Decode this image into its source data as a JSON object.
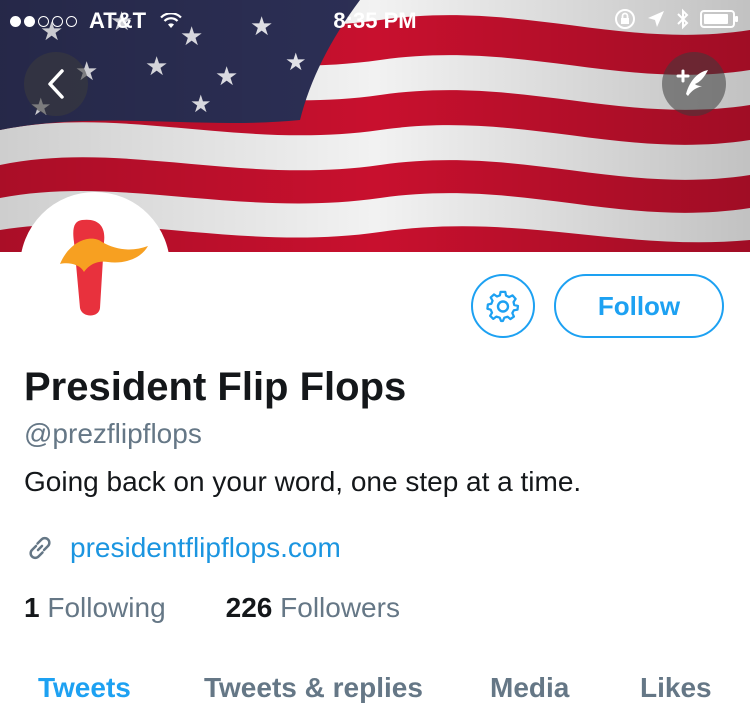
{
  "status_bar": {
    "carrier": "AT&T",
    "time": "8:35 PM",
    "signal_filled": 2,
    "signal_total": 5
  },
  "header": {
    "back_icon": "chevron-left-icon",
    "compose_icon": "compose-tweet-icon"
  },
  "profile": {
    "display_name": "President Flip Flops",
    "handle": "@prezflipflops",
    "bio": "Going back on your word, one step at a time.",
    "website": "presidentflipflops.com",
    "following_count": "1",
    "following_label": "Following",
    "followers_count": "226",
    "followers_label": "Followers"
  },
  "actions": {
    "follow_label": "Follow",
    "settings_icon": "gear-icon"
  },
  "tabs": [
    {
      "label": "Tweets",
      "active": true
    },
    {
      "label": "Tweets & replies",
      "active": false
    },
    {
      "label": "Media",
      "active": false
    },
    {
      "label": "Likes",
      "active": false
    }
  ],
  "colors": {
    "accent": "#1da1f2",
    "link": "#1b95e0",
    "secondary_text": "#657786"
  }
}
